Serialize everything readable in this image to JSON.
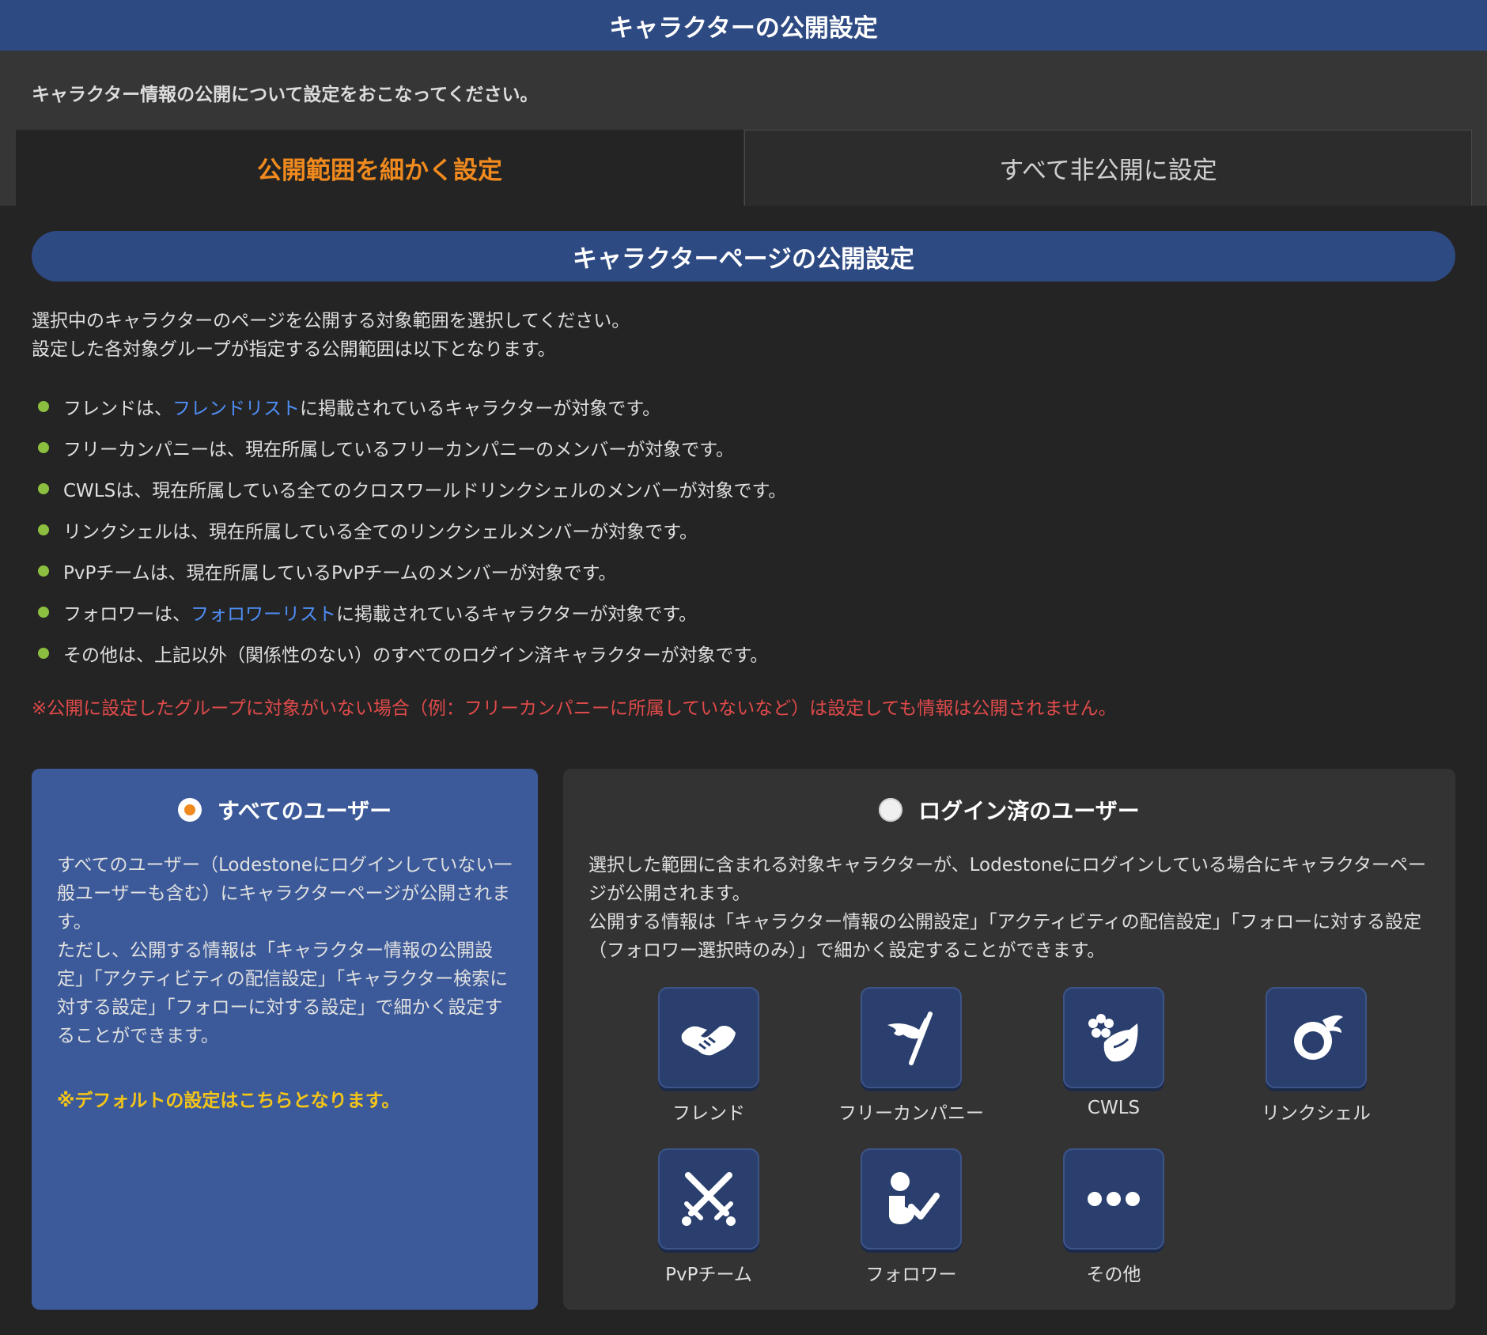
{
  "header": {
    "title": "キャラクターの公開設定"
  },
  "intro": "キャラクター情報の公開について設定をおこなってください。",
  "tabs": {
    "detailed": "公開範囲を細かく設定",
    "all_private": "すべて非公開に設定"
  },
  "section": {
    "title": "キャラクターページの公開設定",
    "description_1": "選択中のキャラクターのページを公開する対象範囲を選択してください。",
    "description_2": "設定した各対象グループが指定する公開範囲は以下となります。"
  },
  "bullets": [
    {
      "pre": "フレンドは、",
      "link": "フレンドリスト",
      "post": "に掲載されているキャラクターが対象です。"
    },
    {
      "pre": "フリーカンパニーは、現在所属しているフリーカンパニーのメンバーが対象です。",
      "link": "",
      "post": ""
    },
    {
      "pre": "CWLSは、現在所属している全てのクロスワールドリンクシェルのメンバーが対象です。",
      "link": "",
      "post": ""
    },
    {
      "pre": "リンクシェルは、現在所属している全てのリンクシェルメンバーが対象です。",
      "link": "",
      "post": ""
    },
    {
      "pre": "PvPチームは、現在所属しているPvPチームのメンバーが対象です。",
      "link": "",
      "post": ""
    },
    {
      "pre": "フォロワーは、",
      "link": "フォロワーリスト",
      "post": "に掲載されているキャラクターが対象です。"
    },
    {
      "pre": "その他は、上記以外（関係性のない）のすべてのログイン済キャラクターが対象です。",
      "link": "",
      "post": ""
    }
  ],
  "notice": "※公開に設定したグループに対象がいない場合（例：フリーカンパニーに所属していないなど）は設定しても情報は公開されません。",
  "option_all": {
    "title": "すべてのユーザー",
    "selected": true,
    "body_1": "すべてのユーザー（Lodestoneにログインしていない一般ユーザーも含む）にキャラクターページが公開されます。",
    "body_2": "ただし、公開する情報は「キャラクター情報の公開設定」「アクティビティの配信設定」「キャラクター検索に対する設定」「フォローに対する設定」で細かく設定することができます。",
    "default_note": "※デフォルトの設定はこちらとなります。"
  },
  "option_login": {
    "title": "ログイン済のユーザー",
    "selected": false,
    "body_1": "選択した範囲に含まれる対象キャラクターが、Lodestoneにログインしている場合にキャラクターページが公開されます。",
    "body_2": "公開する情報は「キャラクター情報の公開設定」「アクティビティの配信設定」「フォローに対する設定（フォロワー選択時のみ）」で細かく設定することができます。",
    "groups": [
      {
        "label": "フレンド",
        "icon": "handshake-icon"
      },
      {
        "label": "フリーカンパニー",
        "icon": "company-flag-icon"
      },
      {
        "label": "CWLS",
        "icon": "flower-shell-icon"
      },
      {
        "label": "リンクシェル",
        "icon": "linkshell-icon"
      },
      {
        "label": "PvPチーム",
        "icon": "crossed-swords-icon"
      },
      {
        "label": "フォロワー",
        "icon": "follower-check-icon"
      },
      {
        "label": "その他",
        "icon": "more-dots-icon"
      }
    ]
  },
  "colors": {
    "header_bg": "#2e4a82",
    "accent_orange": "#f08a1e",
    "link_blue": "#4f8ef7",
    "bullet_green": "#8cbf3f",
    "notice_red": "#e04a4a",
    "default_yellow": "#f5c518",
    "selected_card_bg": "#3c5a99"
  }
}
